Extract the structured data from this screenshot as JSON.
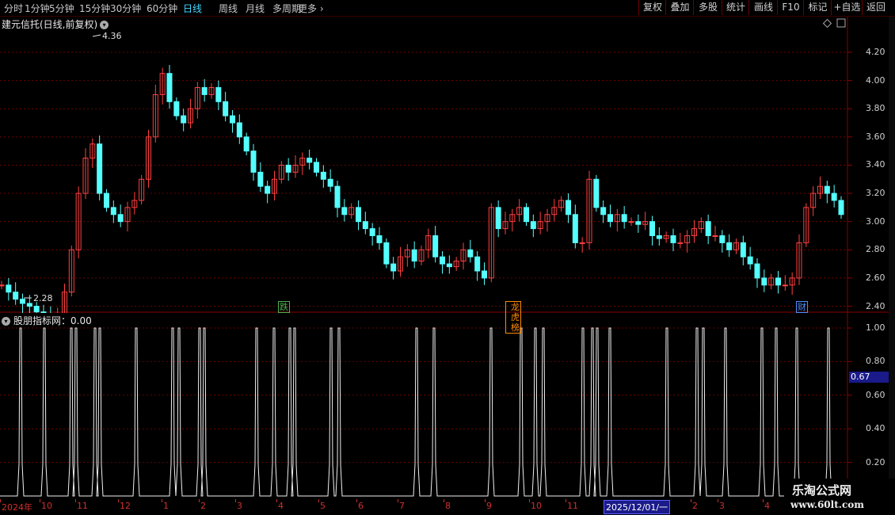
{
  "toolbar": {
    "periods": [
      {
        "label": "分时",
        "active": false
      },
      {
        "label": "1分钟",
        "active": false
      },
      {
        "label": "5分钟",
        "active": false
      },
      {
        "label": "15分钟",
        "active": false
      },
      {
        "label": "30分钟",
        "active": false
      },
      {
        "label": "60分钟",
        "active": false
      },
      {
        "label": "日线",
        "active": true
      },
      {
        "label": "周线",
        "active": false
      },
      {
        "label": "月线",
        "active": false
      },
      {
        "label": "多周期",
        "active": false
      },
      {
        "label": "更多",
        "active": false
      }
    ],
    "actions": [
      "复权",
      "叠加",
      "多股",
      "统计",
      "画线",
      "F10",
      "标记",
      "+自选",
      "返回"
    ]
  },
  "main_panel": {
    "title": "建元信托(日线,前复权)",
    "high_label": "4.36",
    "low_label": "2.28",
    "y_ticks": [
      "4.20",
      "4.00",
      "3.80",
      "3.60",
      "3.40",
      "3.20",
      "3.00",
      "2.80",
      "2.60",
      "2.40"
    ],
    "event_tags": [
      {
        "text": "跌",
        "color": "#4caf50"
      },
      {
        "text": "龙虎榜",
        "color": "#ff8c00"
      },
      {
        "text": "财",
        "color": "#4a90ff"
      }
    ]
  },
  "indicator_panel": {
    "title": "股朋指标网：0.00",
    "y_ticks": [
      "1.00",
      "0.80",
      "0.60",
      "0.40",
      "0.20"
    ],
    "current_value": "0.67"
  },
  "x_axis": {
    "labels": [
      "2024年",
      "10",
      "11",
      "12",
      "1",
      "2",
      "3",
      "4",
      "5",
      "6",
      "7",
      "8",
      "9",
      "10",
      "11",
      "2",
      "3",
      "4"
    ],
    "cursor_date": "2025/12/01/一"
  },
  "watermark": {
    "title": "乐淘公式网",
    "url": "www.60lt.com"
  },
  "chart_data": {
    "type": "candlestick",
    "ylim": [
      2.2,
      4.45
    ],
    "high": 4.36,
    "low": 2.28,
    "close_series": [
      2.55,
      2.5,
      2.45,
      2.42,
      2.4,
      2.36,
      2.33,
      2.32,
      2.35,
      2.5,
      2.8,
      3.2,
      3.45,
      3.55,
      3.2,
      3.1,
      3.05,
      3.0,
      3.1,
      3.15,
      3.3,
      3.6,
      3.9,
      4.05,
      3.85,
      3.75,
      3.7,
      3.8,
      3.95,
      3.9,
      3.95,
      3.85,
      3.75,
      3.7,
      3.6,
      3.5,
      3.35,
      3.25,
      3.2,
      3.3,
      3.4,
      3.35,
      3.4,
      3.45,
      3.42,
      3.35,
      3.3,
      3.25,
      3.1,
      3.05,
      3.1,
      3.0,
      2.95,
      2.9,
      2.85,
      2.7,
      2.65,
      2.75,
      2.8,
      2.72,
      2.8,
      2.9,
      2.75,
      2.7,
      2.68,
      2.72,
      2.8,
      2.75,
      2.65,
      2.6,
      3.1,
      2.95,
      3.0,
      3.05,
      3.1,
      3.0,
      2.95,
      3.0,
      3.05,
      3.1,
      3.15,
      3.05,
      2.85,
      2.85,
      3.3,
      3.1,
      3.05,
      3.0,
      3.05,
      3.0,
      3.0,
      2.98,
      3.0,
      2.9,
      2.88,
      2.9,
      2.85,
      2.85,
      2.9,
      2.95,
      3.0,
      2.9,
      2.9,
      2.85,
      2.8,
      2.85,
      2.75,
      2.7,
      2.6,
      2.55,
      2.6,
      2.55,
      2.55,
      2.6,
      2.85,
      3.1,
      3.2,
      3.25,
      3.2,
      3.15,
      3.05
    ],
    "indicator_series": "binary spikes 0.00 / 1.00"
  }
}
